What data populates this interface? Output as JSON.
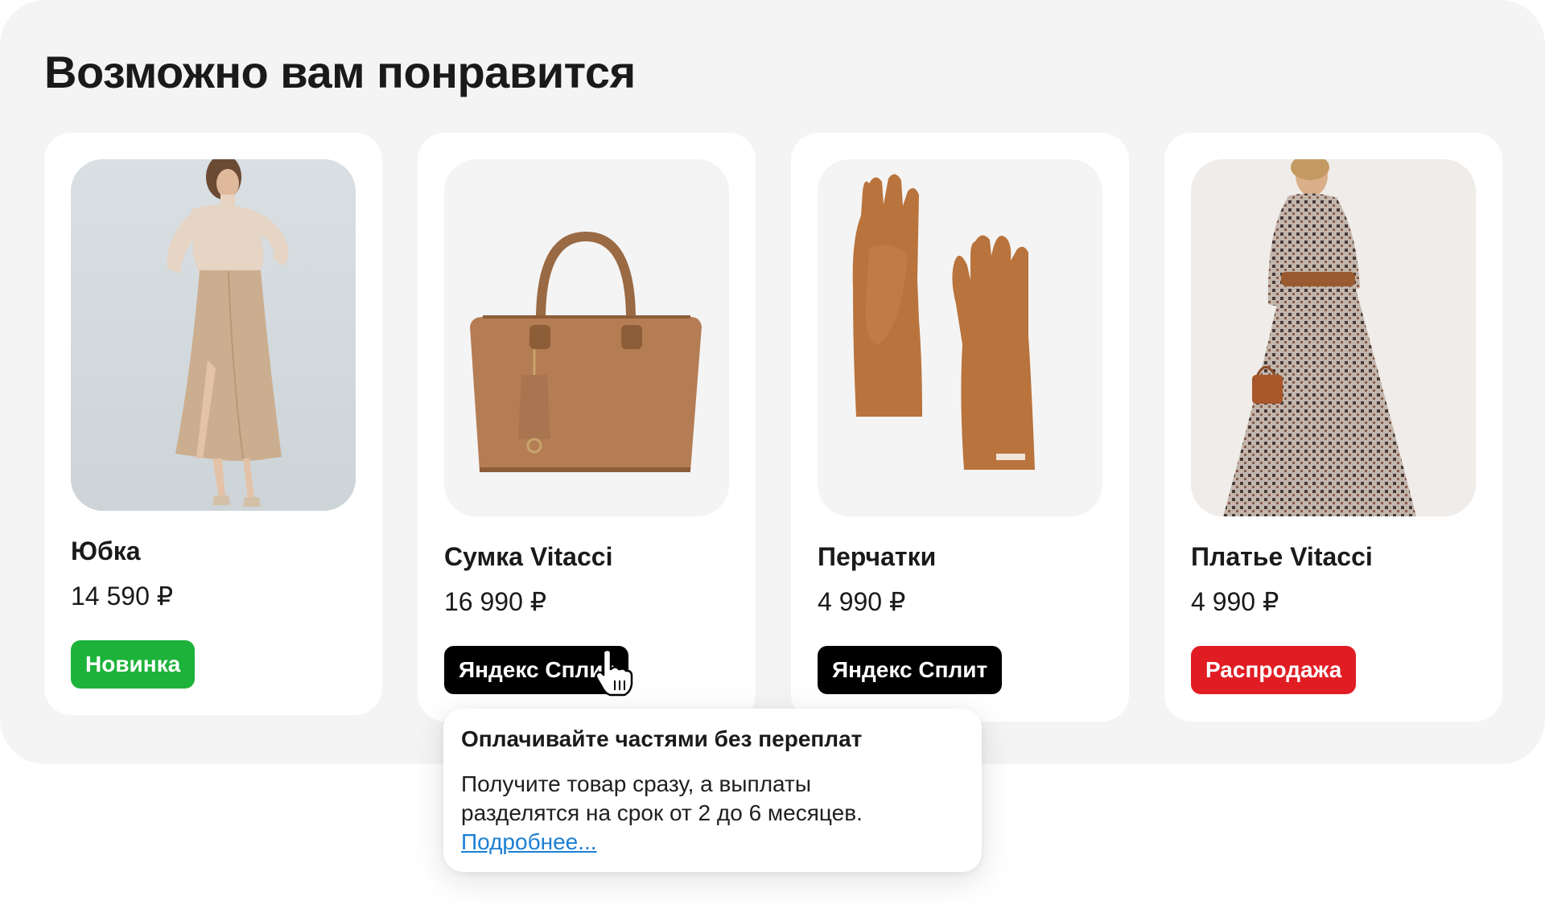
{
  "section": {
    "title": "Возможно вам понравится"
  },
  "products": [
    {
      "name": "Юбка",
      "price": "14 590 ₽",
      "badge": "Новинка",
      "badge_color": "#1db33a",
      "image": "skirt-model-photo"
    },
    {
      "name": "Сумка Vitacci",
      "price": "16 990 ₽",
      "badge": "Яндекс Сплит",
      "badge_color": "#000000",
      "image": "handbag-photo"
    },
    {
      "name": "Перчатки",
      "price": "4 990 ₽",
      "badge": "Яндекс Сплит",
      "badge_color": "#000000",
      "image": "gloves-photo"
    },
    {
      "name": "Платье Vitacci",
      "price": "4 990 ₽",
      "badge": "Распродажа",
      "badge_color": "#e11d24",
      "image": "dress-model-photo"
    }
  ],
  "tooltip": {
    "title": "Оплачивайте частями без переплат",
    "body": "Получите товар сразу, а выплаты разделятся на срок от 2 до 6 месяцев.",
    "link": "Подробнее..."
  },
  "cursor": {
    "icon": "hand-pointer-icon"
  },
  "colors": {
    "panel_bg": "#f4f4f4",
    "card_bg": "#ffffff",
    "link": "#1a7fd4"
  }
}
